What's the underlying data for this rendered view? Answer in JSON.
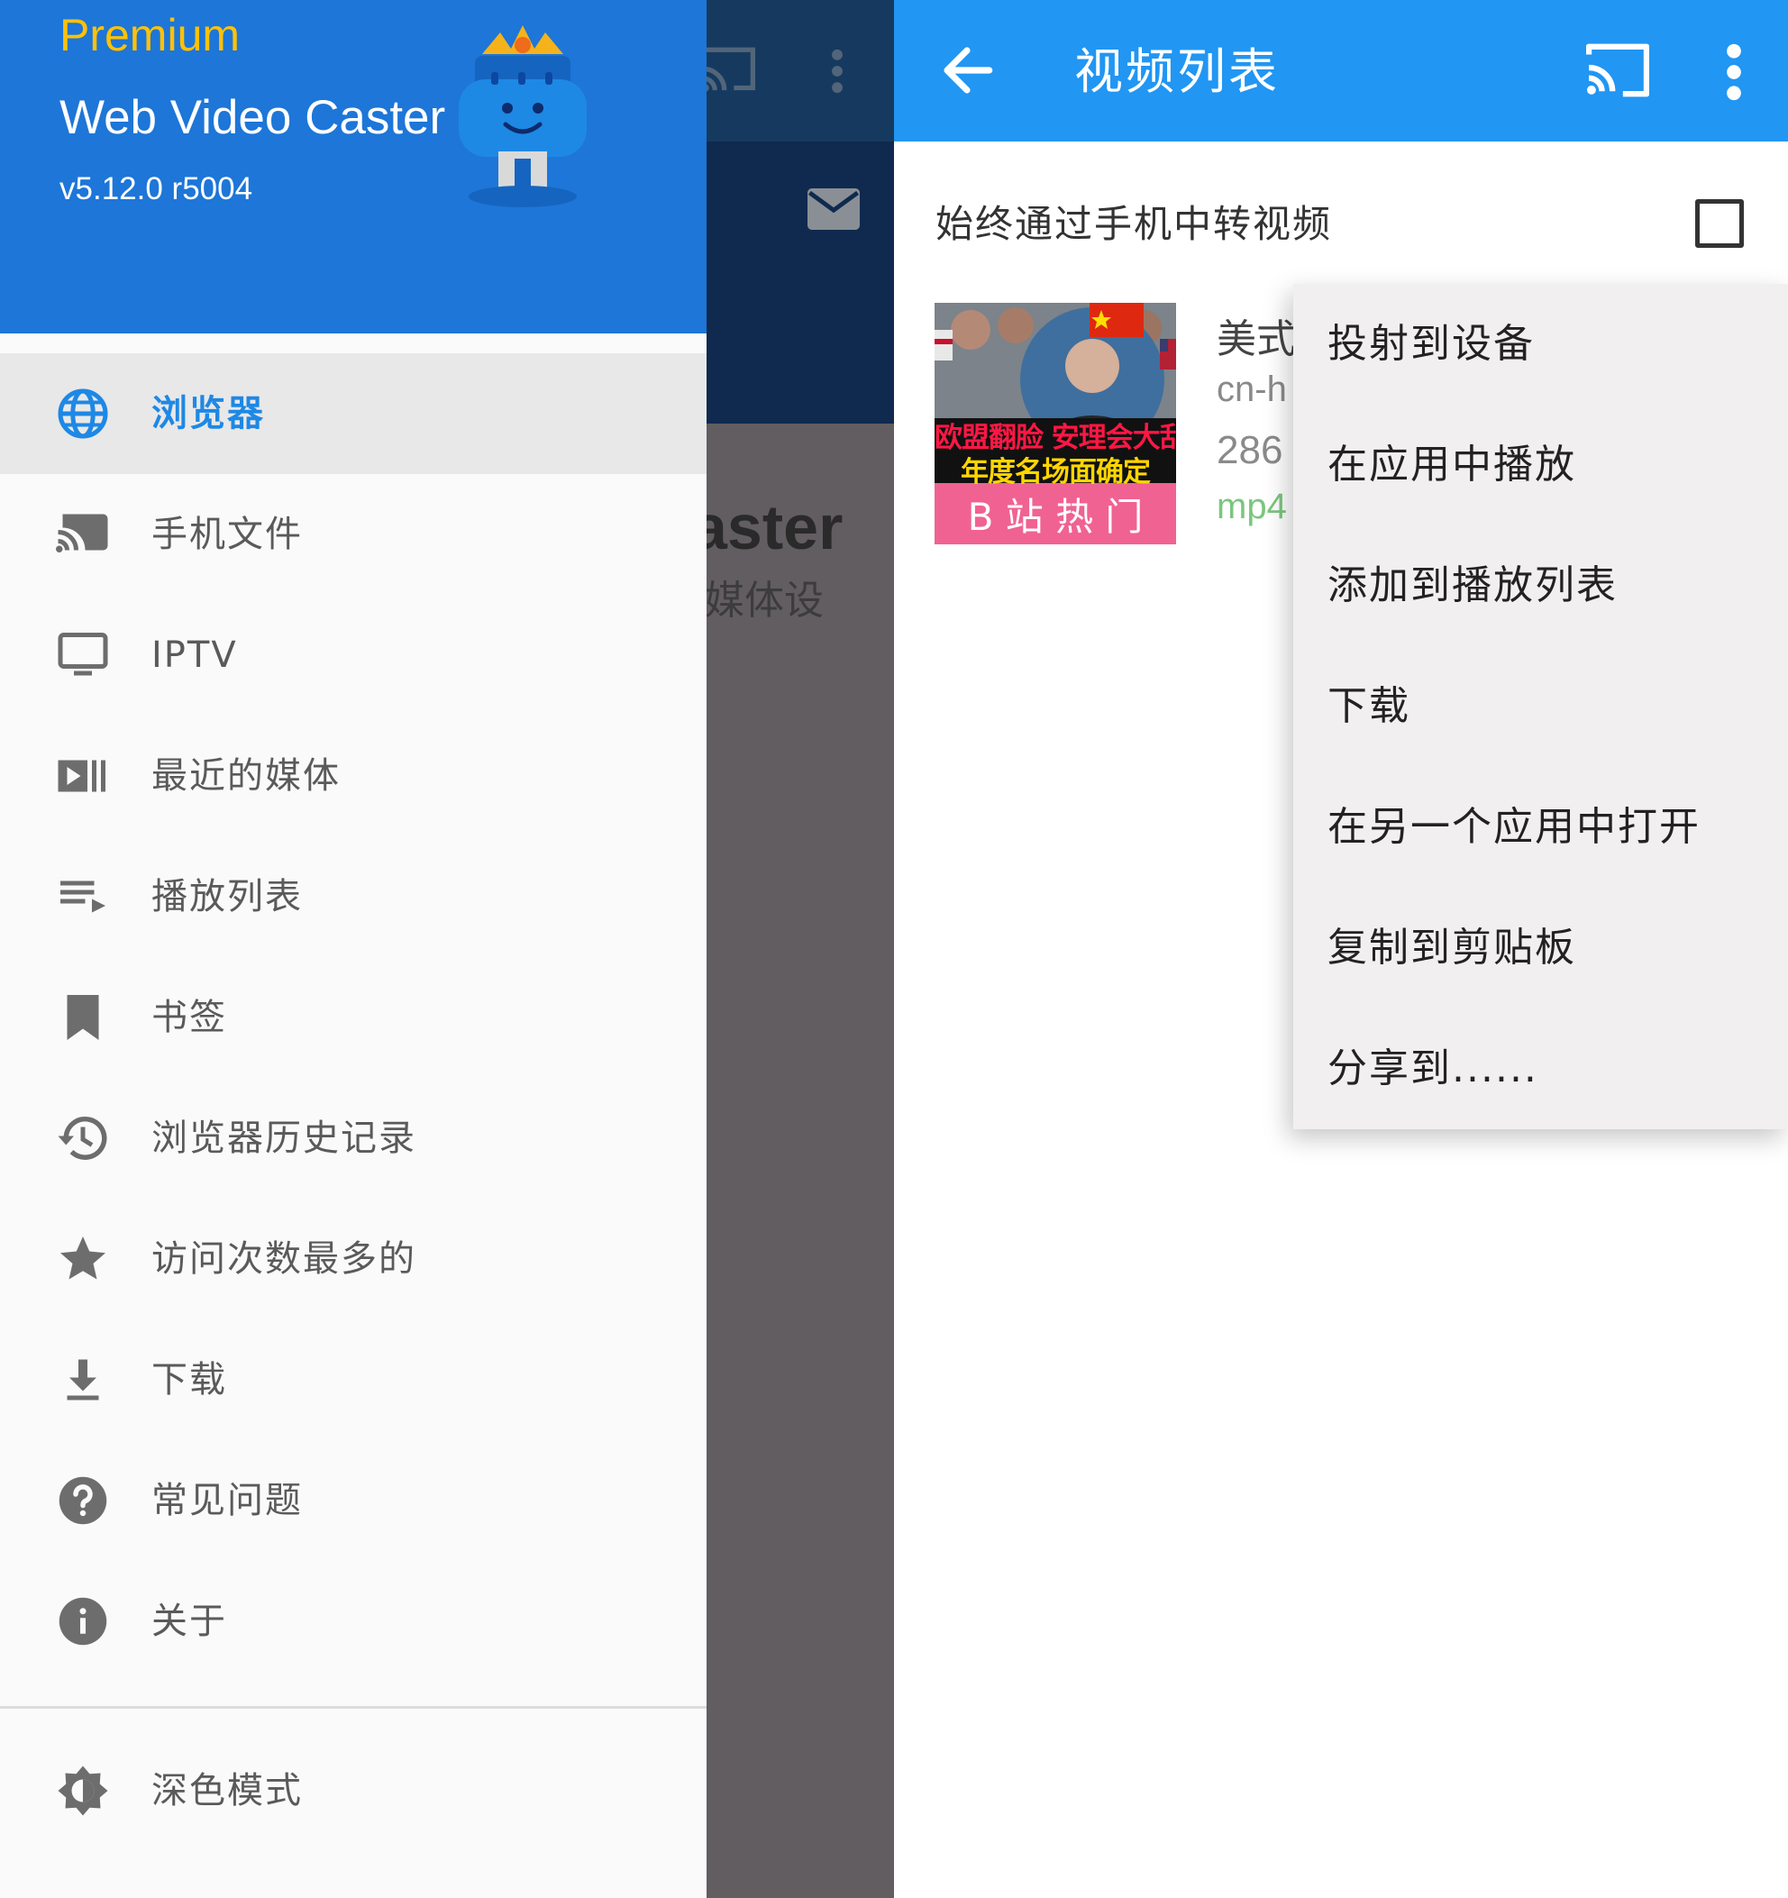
{
  "drawer": {
    "premium_label": "Premium",
    "app_name": "Web Video Caster",
    "version": "v5.12.0 r5004",
    "accent_color": "#1d76d8",
    "items": [
      {
        "label": "浏览器",
        "icon": "globe-icon",
        "active": true
      },
      {
        "label": "手机文件",
        "icon": "cast-files-icon"
      },
      {
        "label": "IPTV",
        "icon": "tv-icon"
      },
      {
        "label": "最近的媒体",
        "icon": "recent-media-icon"
      },
      {
        "label": "播放列表",
        "icon": "playlist-icon"
      },
      {
        "label": "书签",
        "icon": "bookmark-icon"
      },
      {
        "label": "浏览器历史记录",
        "icon": "history-icon"
      },
      {
        "label": "访问次数最多的",
        "icon": "star-icon"
      },
      {
        "label": "下载",
        "icon": "download-icon"
      },
      {
        "label": "常见问题",
        "icon": "help-icon"
      },
      {
        "label": "关于",
        "icon": "info-icon"
      }
    ],
    "bottom_items": [
      {
        "label": "深色模式",
        "icon": "brightness-icon"
      }
    ]
  },
  "background_app": {
    "title_fragment": "aster",
    "subtitle_fragment": "媒体设"
  },
  "video_list": {
    "title": "视频列表",
    "accent_color": "#2196f3",
    "relay_label": "始终通过手机中转视频",
    "relay_checked": false,
    "video": {
      "title_fragment": "美式",
      "host_fragment": "cn-h",
      "size_fragment": "286",
      "format_fragment": "mp4",
      "thumb_headline_1": "欧盟翻脸 安理会大乱",
      "thumb_headline_2": "年度名场面确定",
      "thumb_badge": "B 站 热 门"
    }
  },
  "popup_menu": {
    "items": [
      "投射到设备",
      "在应用中播放",
      "添加到播放列表",
      "下载",
      "在另一个应用中打开",
      "复制到剪贴板",
      "分享到......"
    ]
  }
}
